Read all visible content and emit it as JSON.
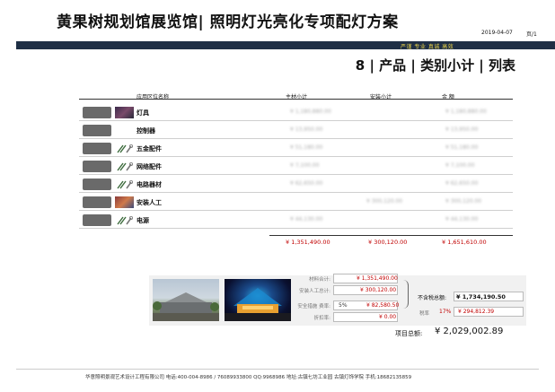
{
  "header": {
    "title": "黄果树规划馆展览馆| 照明灯光亮化专项配灯方案",
    "date": "2019-04-07",
    "page": "页/1",
    "slogan": "严谨  专业  真诚  高效"
  },
  "section_title": "8 | 产品 | 类别小计 | 列表",
  "table": {
    "columns": [
      "应用区位名称",
      "主材小计",
      "安装小计",
      "金    额"
    ],
    "rows": [
      {
        "name": "灯具",
        "material": "¥ 1,180,880.00",
        "install": "",
        "amount": "¥ 1,180,880.00",
        "thumb": "lamp"
      },
      {
        "name": "控制器",
        "material": "¥ 13,950.00",
        "install": "",
        "amount": "¥ 13,950.00",
        "thumb": "none"
      },
      {
        "name": "五金配件",
        "material": "¥ 51,180.00",
        "install": "",
        "amount": "¥ 51,180.00",
        "thumb": "tools"
      },
      {
        "name": "网络配件",
        "material": "¥ 7,100.00",
        "install": "",
        "amount": "¥ 7,100.00",
        "thumb": "tools"
      },
      {
        "name": "电路器材",
        "material": "¥ 62,650.00",
        "install": "",
        "amount": "¥ 62,650.00",
        "thumb": "tools"
      },
      {
        "name": "安装人工",
        "material": "",
        "install": "¥ 300,120.00",
        "amount": "¥ 300,120.00",
        "thumb": "people"
      },
      {
        "name": "电源",
        "material": "¥ 44,130.00",
        "install": "",
        "amount": "¥ 44,130.00",
        "thumb": "tools"
      }
    ],
    "totals": {
      "material": "¥ 1,351,490.00",
      "install": "¥ 300,120.00",
      "amount": "¥ 1,651,610.00"
    }
  },
  "summary": {
    "material_label": "材料合计:",
    "material_value": "¥ 1,351,490.00",
    "labor_label": "安装人工总计:",
    "labor_value": "¥ 300,120.00",
    "safety_label": "安全措施 费率:",
    "safety_rate": "5%",
    "safety_value": "¥ 82,580.50",
    "discount_label": "折扣率:",
    "discount_value": "¥ 0.00",
    "pretax_label": "不含税总额:",
    "pretax_value": "¥ 1,734,190.50",
    "tax_label": "税率",
    "tax_rate": "17%",
    "tax_value": "¥ 294,812.39",
    "grand_label": "项目总额:",
    "grand_value": "¥ 2,029,002.89"
  },
  "footer": "华意照明景观艺术设计工程有限公司  电话:400-004-8986 / 76089933800   QQ:9968986  地址:古镇七坊工业园  古镇灯饰学院   手机:18682135859",
  "colors": {
    "header_bar": "#1f2f45",
    "slogan": "#e8d24a",
    "money_red": "#c00000"
  }
}
